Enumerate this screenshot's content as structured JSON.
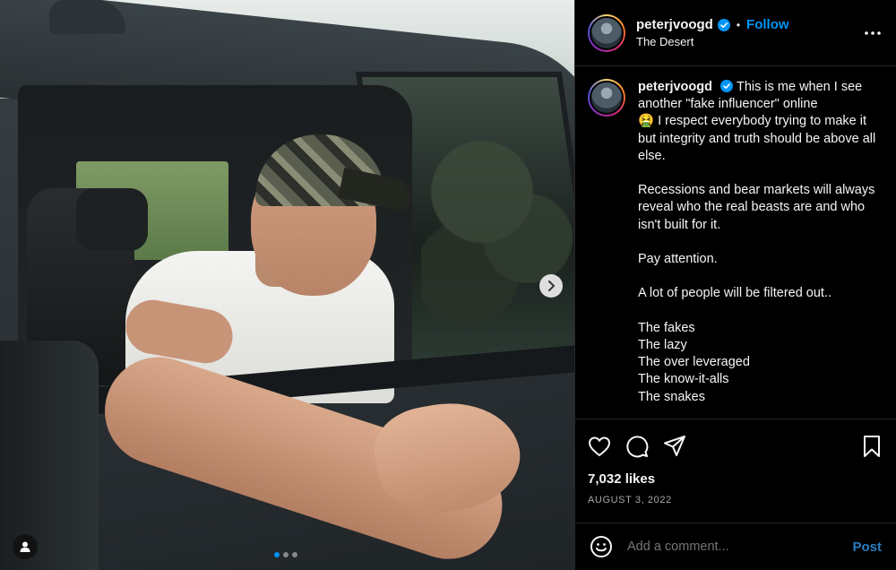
{
  "post": {
    "username": "peterjvoogd",
    "location": "The Desert",
    "follow_label": "Follow",
    "separator": "•",
    "caption": {
      "username": "peterjvoogd",
      "first_line": "This is me when I see another \"fake influencer\" online",
      "emoji": "🤮",
      "first_line_cont": "I respect everybody trying to make it but integrity and truth should be above all else.",
      "paragraph2": "Recessions and bear markets will always reveal who the real beasts are and who isn't built for it.",
      "paragraph3": "Pay attention.",
      "paragraph4": "A lot of people will be filtered out..",
      "list": [
        "The fakes",
        "The lazy",
        "The over leveraged",
        "The know-it-alls",
        "The snakes"
      ]
    },
    "likes": "7,032 likes",
    "date": "AUGUST 3, 2022",
    "comment_placeholder": "Add a comment...",
    "post_label": "Post",
    "carousel": {
      "total": 3,
      "active": 1
    }
  },
  "icons": {
    "more": "more-options-icon",
    "like": "heart-icon",
    "comment": "comment-icon",
    "share": "share-icon",
    "save": "bookmark-icon",
    "emoji": "emoji-icon",
    "next": "chevron-right-icon",
    "user_tag": "user-tag-icon",
    "verified": "verified-badge-icon"
  },
  "colors": {
    "accent": "#0095f6",
    "post_button": "#2b7dc0",
    "background": "#000000",
    "text": "#f5f5f5",
    "muted": "#a8a8a8"
  }
}
